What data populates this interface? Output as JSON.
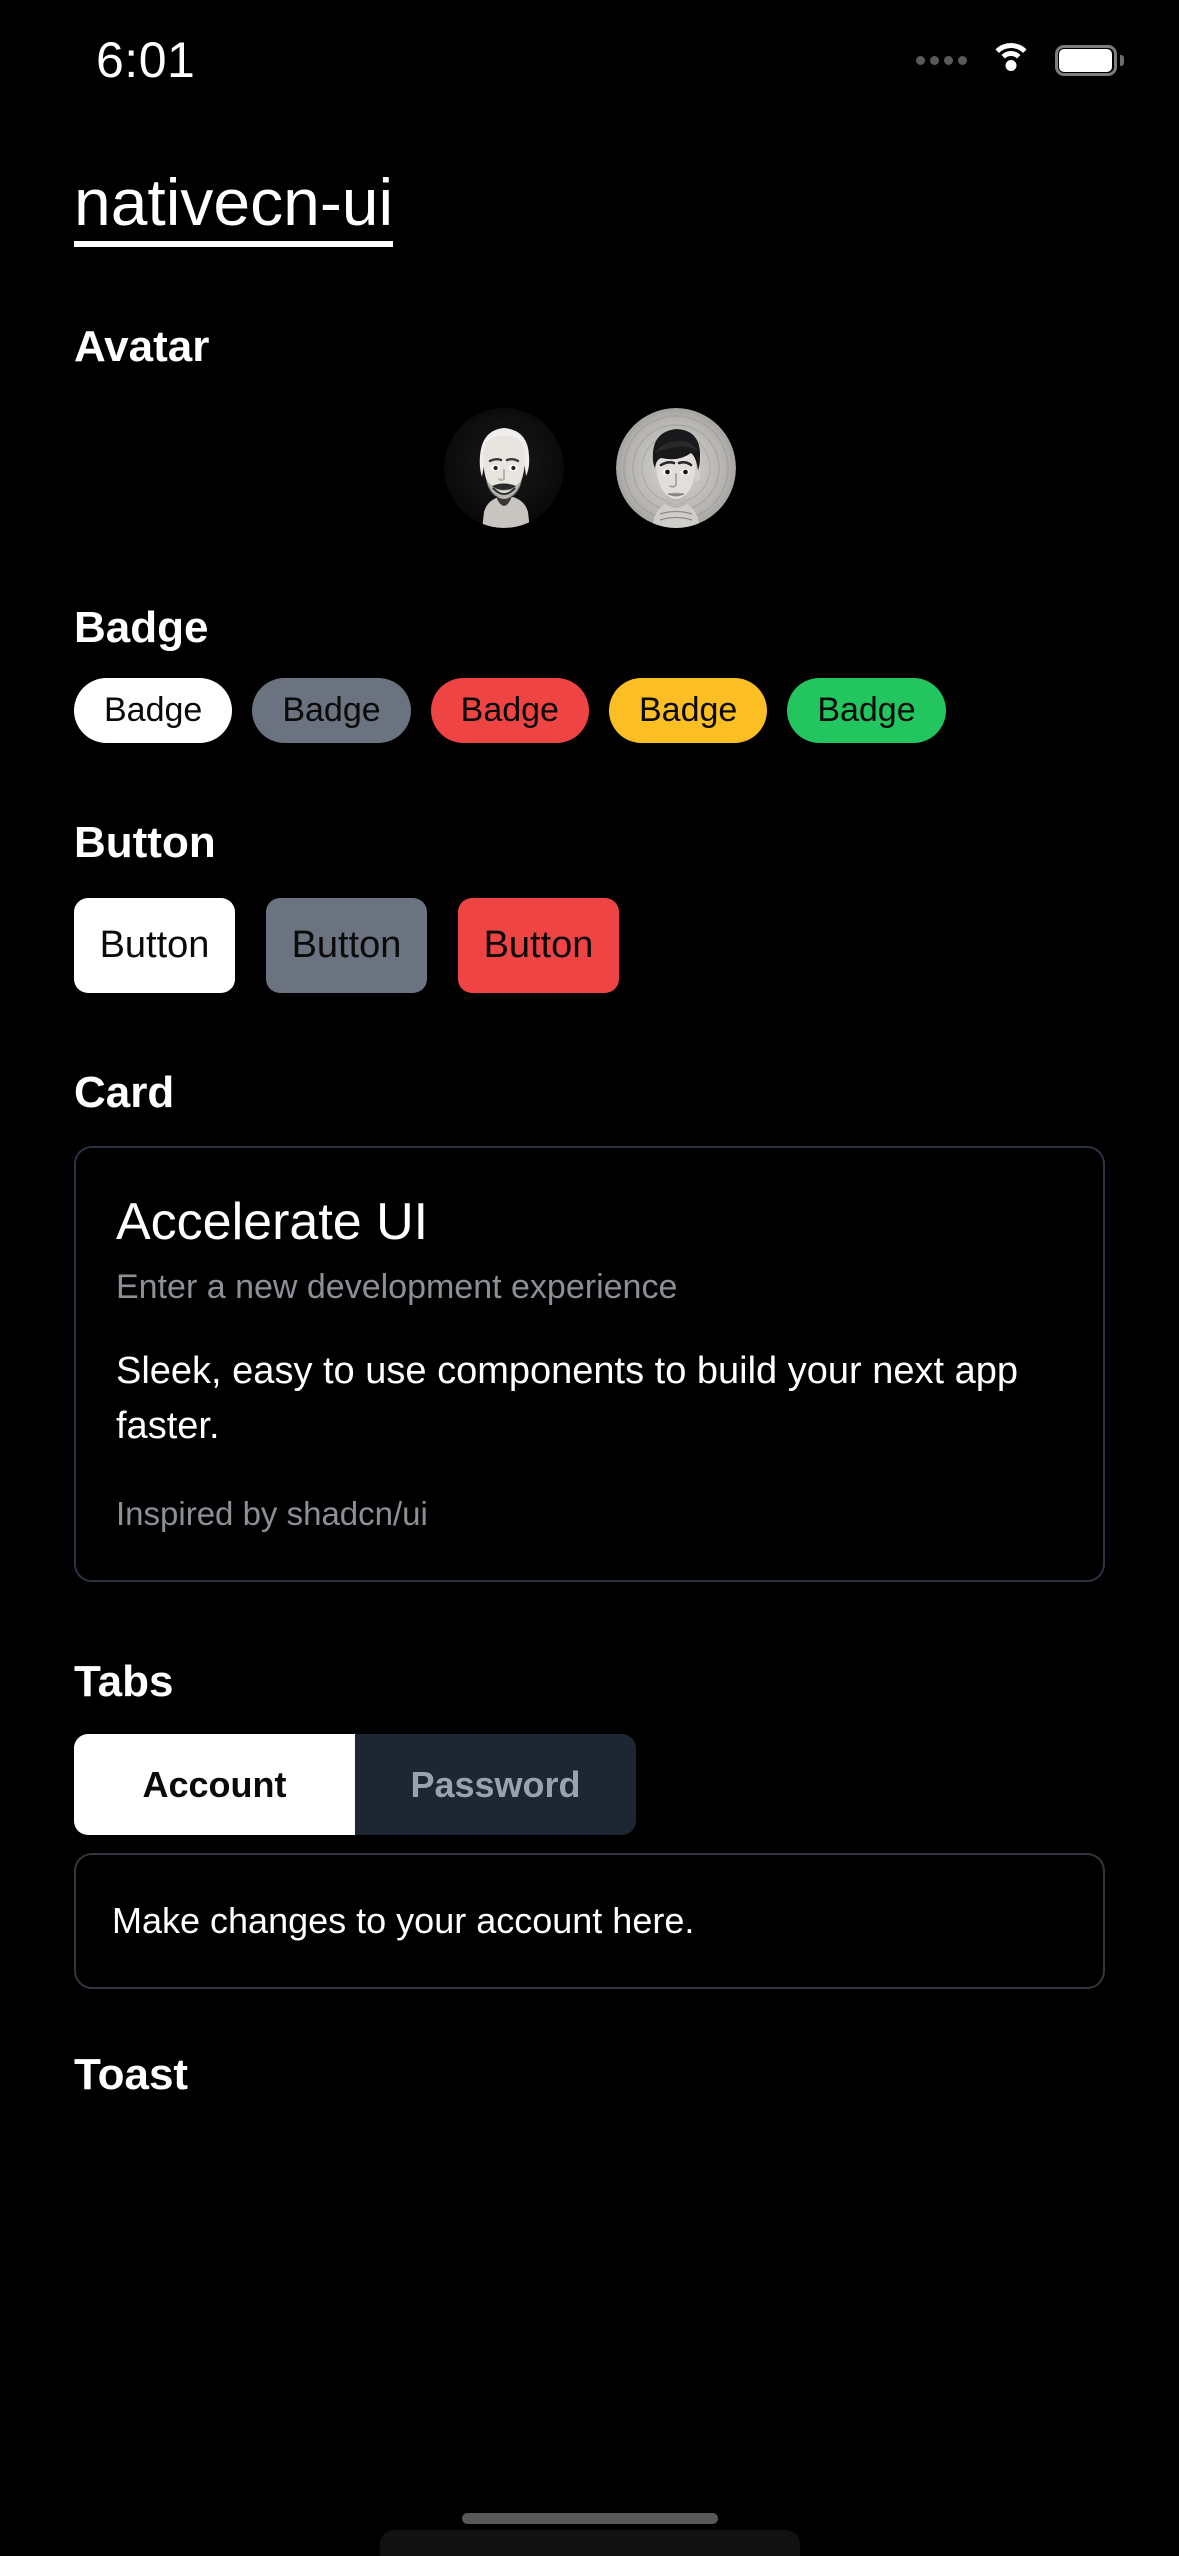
{
  "status_bar": {
    "time": "6:01",
    "cellular_icon": "signal-dots-icon",
    "wifi_icon": "wifi-icon",
    "battery_icon": "battery-full-icon"
  },
  "page": {
    "title": "nativecn-ui"
  },
  "sections": {
    "avatar": {
      "title": "Avatar",
      "items": [
        {
          "name": "avatar-photo-man-smiling",
          "alt": "Black and white photo of smiling bearded man"
        },
        {
          "name": "avatar-illustration-young-man",
          "alt": "Grayscale illustration of young man with dark hair"
        }
      ]
    },
    "badge": {
      "title": "Badge",
      "items": [
        {
          "label": "Badge",
          "color": "#ffffff",
          "text_color": "#0a0a0a",
          "variant": "default"
        },
        {
          "label": "Badge",
          "color": "#6b7280",
          "text_color": "#0a0a0a",
          "variant": "secondary"
        },
        {
          "label": "Badge",
          "color": "#ef4444",
          "text_color": "#0a0a0a",
          "variant": "destructive"
        },
        {
          "label": "Badge",
          "color": "#fbbf24",
          "text_color": "#0a0a0a",
          "variant": "warning"
        },
        {
          "label": "Badge",
          "color": "#22c55e",
          "text_color": "#0a0a0a",
          "variant": "success"
        }
      ]
    },
    "button": {
      "title": "Button",
      "items": [
        {
          "label": "Button",
          "color": "#ffffff",
          "text_color": "#0a0a0a",
          "variant": "default"
        },
        {
          "label": "Button",
          "color": "#6b7280",
          "text_color": "#0a0a0a",
          "variant": "secondary"
        },
        {
          "label": "Button",
          "color": "#ef4444",
          "text_color": "#0a0a0a",
          "variant": "destructive"
        }
      ]
    },
    "card": {
      "title": "Card",
      "heading": "Accelerate UI",
      "subtitle": "Enter a new development experience",
      "body": "Sleek, easy to use components to build your next app faster.",
      "footer": "Inspired by shadcn/ui"
    },
    "tabs": {
      "title": "Tabs",
      "items": [
        {
          "label": "Account",
          "active": true
        },
        {
          "label": "Password",
          "active": false
        }
      ],
      "panel_text": "Make changes to your account here."
    },
    "toast": {
      "title": "Toast"
    }
  },
  "colors": {
    "background": "#000000",
    "card_border": "#2c3240",
    "tab_inactive_bg": "#1d2633",
    "muted_text": "#8b8f96"
  }
}
